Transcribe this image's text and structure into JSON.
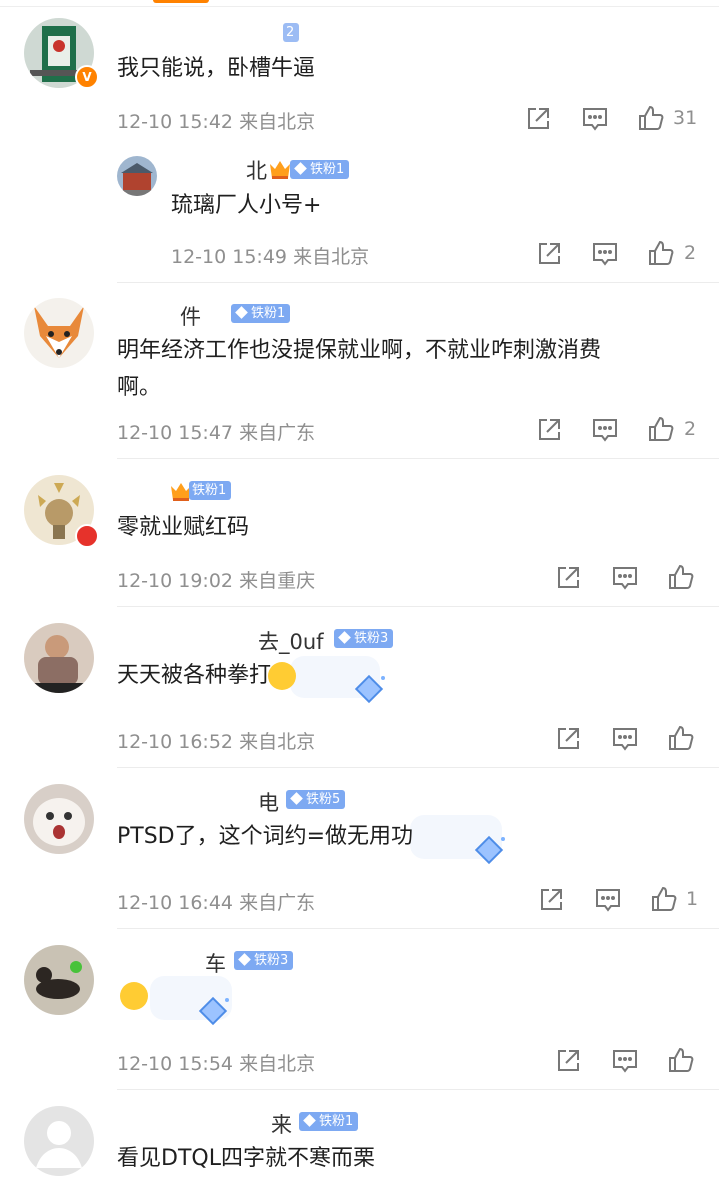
{
  "comments": [
    {
      "name": "",
      "fan": "2",
      "text": "我只能说，卧槽牛逼",
      "time": "12-10 15:42",
      "loc": "来自北京",
      "likes": "31"
    },
    {
      "name": "北",
      "fan": "铁粉1",
      "text": "琉璃厂人小号+",
      "time": "12-10 15:49",
      "loc": "来自北京",
      "likes": "2"
    },
    {
      "name": "件",
      "fan": "铁粉1",
      "text": "明年经济工作也没提保就业啊，不就业咋刺激消费",
      "text2": "啊。",
      "time": "12-10 15:47",
      "loc": "来自广东",
      "likes": "2"
    },
    {
      "name": "",
      "fan": "铁粉1",
      "text": "零就业赋红码",
      "time": "12-10 19:02",
      "loc": "来自重庆",
      "likes": ""
    },
    {
      "name": "去_0uf",
      "fan": "铁粉3",
      "text": "天天被各种拳打",
      "time": "12-10 16:52",
      "loc": "来自北京",
      "likes": ""
    },
    {
      "name": "电",
      "fan": "铁粉5",
      "text": "PTSD了，这个词约=做无用功",
      "time": "12-10 16:44",
      "loc": "来自广东",
      "likes": "1"
    },
    {
      "name": "车",
      "fan": "铁粉3",
      "text": "",
      "time": "12-10 15:54",
      "loc": "来自北京",
      "likes": ""
    },
    {
      "name": "来",
      "fan": "铁粉1",
      "text": "看见DTQL四字就不寒而栗",
      "time": "",
      "loc": "",
      "likes": ""
    }
  ],
  "icons": {
    "share": "share-icon",
    "comment": "comment-icon",
    "like": "thumbs-up-icon",
    "avatar_badge": "verified-v-icon"
  },
  "colors": {
    "accent": "#ff8200",
    "fan_badge": "#7da9f2",
    "meta_text": "#8f8f8f"
  }
}
